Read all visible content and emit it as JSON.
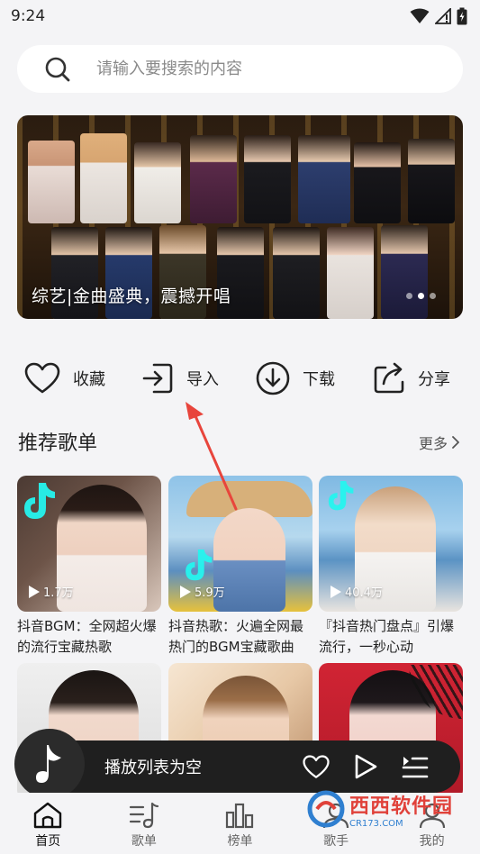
{
  "status_bar": {
    "time": "9:24",
    "icons": [
      "wifi-icon",
      "signal-icon",
      "battery-icon"
    ]
  },
  "search": {
    "placeholder": "请输入要搜索的内容"
  },
  "banner": {
    "caption": "综艺|金曲盛典，震撼开唱",
    "dot_count": 3,
    "active_dot": 2
  },
  "actions": [
    {
      "label": "收藏",
      "icon": "heart-icon"
    },
    {
      "label": "导入",
      "icon": "import-icon"
    },
    {
      "label": "下载",
      "icon": "download-icon"
    },
    {
      "label": "分享",
      "icon": "share-icon"
    }
  ],
  "recommend": {
    "title": "推荐歌单",
    "more_label": "更多"
  },
  "playlists": [
    {
      "title": "抖音BGM：全网超火爆的流行宝藏热歌",
      "play_count": "1.7万"
    },
    {
      "title": "抖音热歌：火遍全网最热门的BGM宝藏歌曲",
      "play_count": "5.9万"
    },
    {
      "title": "『抖音热门盘点』引爆流行，一秒心动",
      "play_count": "40.4万"
    },
    {
      "title": "",
      "play_count": ""
    },
    {
      "title": "",
      "play_count": ""
    },
    {
      "title": "",
      "play_count": ""
    }
  ],
  "player": {
    "status": "播放列表为空"
  },
  "nav": [
    {
      "label": "首页",
      "icon": "home-icon",
      "active": true
    },
    {
      "label": "歌单",
      "icon": "music-list-icon",
      "active": false
    },
    {
      "label": "榜单",
      "icon": "chart-icon",
      "active": false
    },
    {
      "label": "歌手",
      "icon": "singer-icon",
      "active": false
    },
    {
      "label": "我的",
      "icon": "profile-icon",
      "active": false
    }
  ],
  "watermark": {
    "text": "西西软件园",
    "sub": "CR173.COM"
  },
  "colors": {
    "accent_annotation": "#e8453c",
    "player_bg": "#1f1f1f",
    "page_bg": "#f4f4f6"
  }
}
